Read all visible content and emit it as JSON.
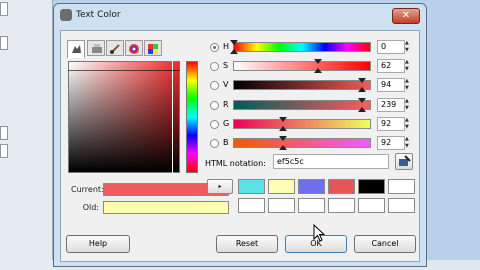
{
  "window": {
    "title": "Text Color",
    "close_glyph": "✕"
  },
  "tabs": [
    {
      "name": "gimp-selector",
      "icon": "wilber-icon"
    },
    {
      "name": "cmyk",
      "icon": "printer-icon"
    },
    {
      "name": "watercolor",
      "icon": "brush-icon"
    },
    {
      "name": "wheel",
      "icon": "color-wheel-icon"
    },
    {
      "name": "scales",
      "icon": "palette-icon"
    }
  ],
  "swatches": {
    "current_label": "Current:",
    "old_label": "Old:",
    "current_color": "#ef5c5c",
    "old_color": "#ffffb4"
  },
  "channels": [
    {
      "label": "H",
      "value": "0",
      "selected": true,
      "level": 0.0
    },
    {
      "label": "S",
      "value": "62",
      "selected": false,
      "level": 0.62
    },
    {
      "label": "V",
      "value": "94",
      "selected": false,
      "level": 0.94
    },
    {
      "label": "R",
      "value": "239",
      "selected": false,
      "level": 0.94
    },
    {
      "label": "G",
      "value": "92",
      "selected": false,
      "level": 0.36
    },
    {
      "label": "B",
      "value": "92",
      "selected": false,
      "level": 0.36
    }
  ],
  "html_notation": {
    "label": "HTML notation:",
    "value": "ef5c5c"
  },
  "history": {
    "arrow_glyph": "▸",
    "colors": [
      "#5be2e6",
      "#ffffb4",
      "#6e6ef0",
      "#e75656",
      "#000000",
      "#ffffff",
      "#ffffff",
      "#ffffff",
      "#ffffff",
      "#ffffff",
      "#ffffff",
      "#ffffff"
    ]
  },
  "buttons": {
    "help": "Help",
    "reset": "Reset",
    "ok": "OK",
    "cancel": "Cancel"
  }
}
